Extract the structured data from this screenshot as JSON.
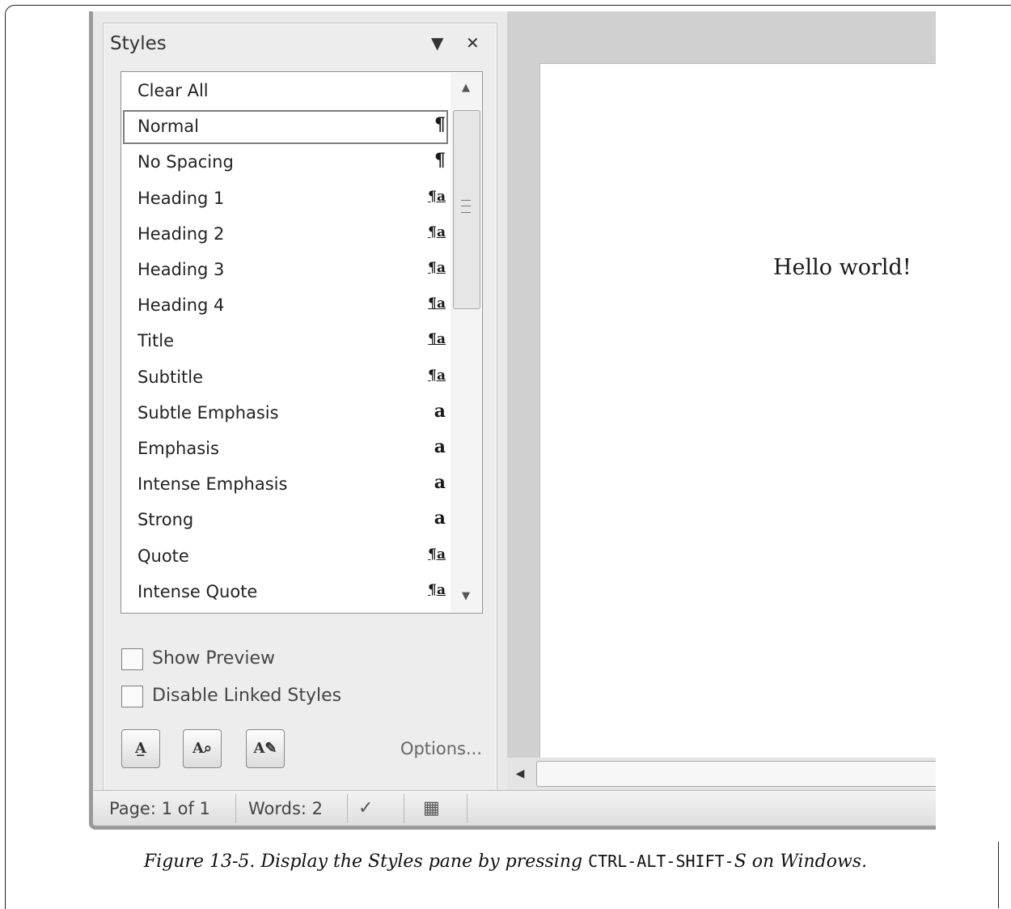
{
  "pane": {
    "title": "Styles",
    "menu_icon": "dropdown-arrow-icon",
    "close_icon": "close-icon",
    "styles": [
      {
        "name": "Clear All",
        "indicator": ""
      },
      {
        "name": "Normal",
        "indicator": "¶"
      },
      {
        "name": "No Spacing",
        "indicator": "¶"
      },
      {
        "name": "Heading 1",
        "indicator": "¶a"
      },
      {
        "name": "Heading 2",
        "indicator": "¶a"
      },
      {
        "name": "Heading 3",
        "indicator": "¶a"
      },
      {
        "name": "Heading 4",
        "indicator": "¶a"
      },
      {
        "name": "Title",
        "indicator": "¶a"
      },
      {
        "name": "Subtitle",
        "indicator": "¶a"
      },
      {
        "name": "Subtle Emphasis",
        "indicator": "a"
      },
      {
        "name": "Emphasis",
        "indicator": "a"
      },
      {
        "name": "Intense Emphasis",
        "indicator": "a"
      },
      {
        "name": "Strong",
        "indicator": "a"
      },
      {
        "name": "Quote",
        "indicator": "¶a"
      },
      {
        "name": "Intense Quote",
        "indicator": "¶a"
      }
    ],
    "selected_style": "Normal",
    "show_preview_label": "Show Preview",
    "show_preview_checked": false,
    "disable_linked_label": "Disable Linked Styles",
    "disable_linked_checked": false,
    "new_style_icon": "new-style-icon",
    "style_inspector_icon": "style-inspector-icon",
    "manage_styles_icon": "manage-styles-icon",
    "options_label": "Options..."
  },
  "document": {
    "text": "Hello world!"
  },
  "status_bar": {
    "page": "Page: 1 of 1",
    "words": "Words: 2",
    "proofing_icon": "proofing-icon",
    "layout_icon": "layout-icon"
  },
  "caption": {
    "prefix": "Figure 13-5. Display the Styles pane by pressing ",
    "keys": "CTRL-ALT-SHIFT-",
    "key_letter": "S",
    "suffix": " on Windows."
  }
}
